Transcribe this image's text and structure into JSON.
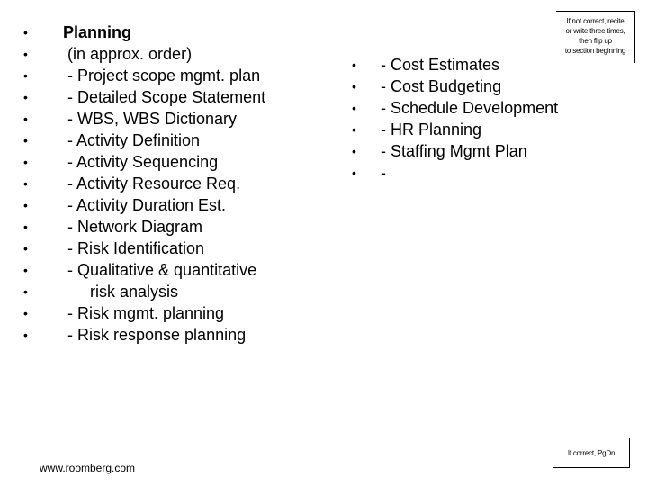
{
  "bullet_glyph": "•",
  "left_list": {
    "items": [
      {
        "text": "Planning",
        "heading": true
      },
      {
        "text": " (in approx. order)"
      },
      {
        "text": " - Project scope mgmt. plan"
      },
      {
        "text": " - Detailed Scope Statement"
      },
      {
        "text": " - WBS, WBS Dictionary"
      },
      {
        "text": " - Activity Definition"
      },
      {
        "text": " - Activity Sequencing"
      },
      {
        "text": " - Activity Resource Req."
      },
      {
        "text": " - Activity Duration Est."
      },
      {
        "text": " - Network Diagram"
      },
      {
        "text": " - Risk Identification"
      },
      {
        "text": " - Qualitative & quantitative"
      },
      {
        "text": "      risk analysis"
      },
      {
        "text": " - Risk mgmt. planning"
      },
      {
        "text": " - Risk response planning"
      }
    ]
  },
  "right_list": {
    "items": [
      {
        "text": "- Cost Estimates"
      },
      {
        "text": "- Cost Budgeting"
      },
      {
        "text": "- Schedule Development"
      },
      {
        "text": "- HR Planning"
      },
      {
        "text": "- Staffing Mgmt Plan"
      },
      {
        "text": "-"
      }
    ]
  },
  "note_top": {
    "lines": [
      "If not correct, recite",
      "or write three times,",
      "then flip up",
      "to section beginning"
    ]
  },
  "note_bottom": {
    "text": "If correct, PgDn"
  },
  "footer": {
    "url_text": "www.roomberg.com"
  }
}
